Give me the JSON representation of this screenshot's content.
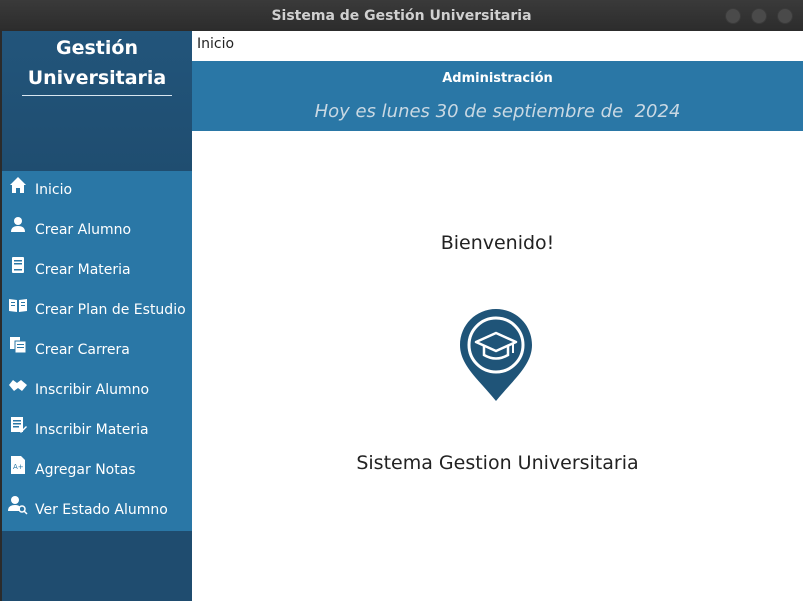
{
  "window": {
    "title": "Sistema de Gestión Universitaria"
  },
  "sidebar": {
    "brand_line1": "Gestión",
    "brand_line2": "Universitaria",
    "items": [
      {
        "label": "Inicio",
        "icon": "home-icon"
      },
      {
        "label": "Crear Alumno",
        "icon": "user-icon"
      },
      {
        "label": "Crear Materia",
        "icon": "book-icon"
      },
      {
        "label": "Crear Plan de Estudio",
        "icon": "open-book-icon"
      },
      {
        "label": "Crear Carrera",
        "icon": "documents-icon"
      },
      {
        "label": "Inscribir Alumno",
        "icon": "handshake-icon"
      },
      {
        "label": "Inscribir Materia",
        "icon": "edit-list-icon"
      },
      {
        "label": "Agregar Notas",
        "icon": "grade-document-icon"
      },
      {
        "label": "Ver Estado Alumno",
        "icon": "user-search-icon"
      }
    ]
  },
  "main": {
    "breadcrumb": "Inicio",
    "header_title": "Administración",
    "date_text": "Hoy es lunes 30 de septiembre de  2024",
    "welcome": "Bienvenido!",
    "system_name": "Sistema Gestion Universitaria",
    "logo_icon": "graduation-cap-pin-icon"
  },
  "colors": {
    "sidebar_dark": "#1e4f73",
    "accent": "#2a77a6",
    "logo": "#1f5478"
  }
}
